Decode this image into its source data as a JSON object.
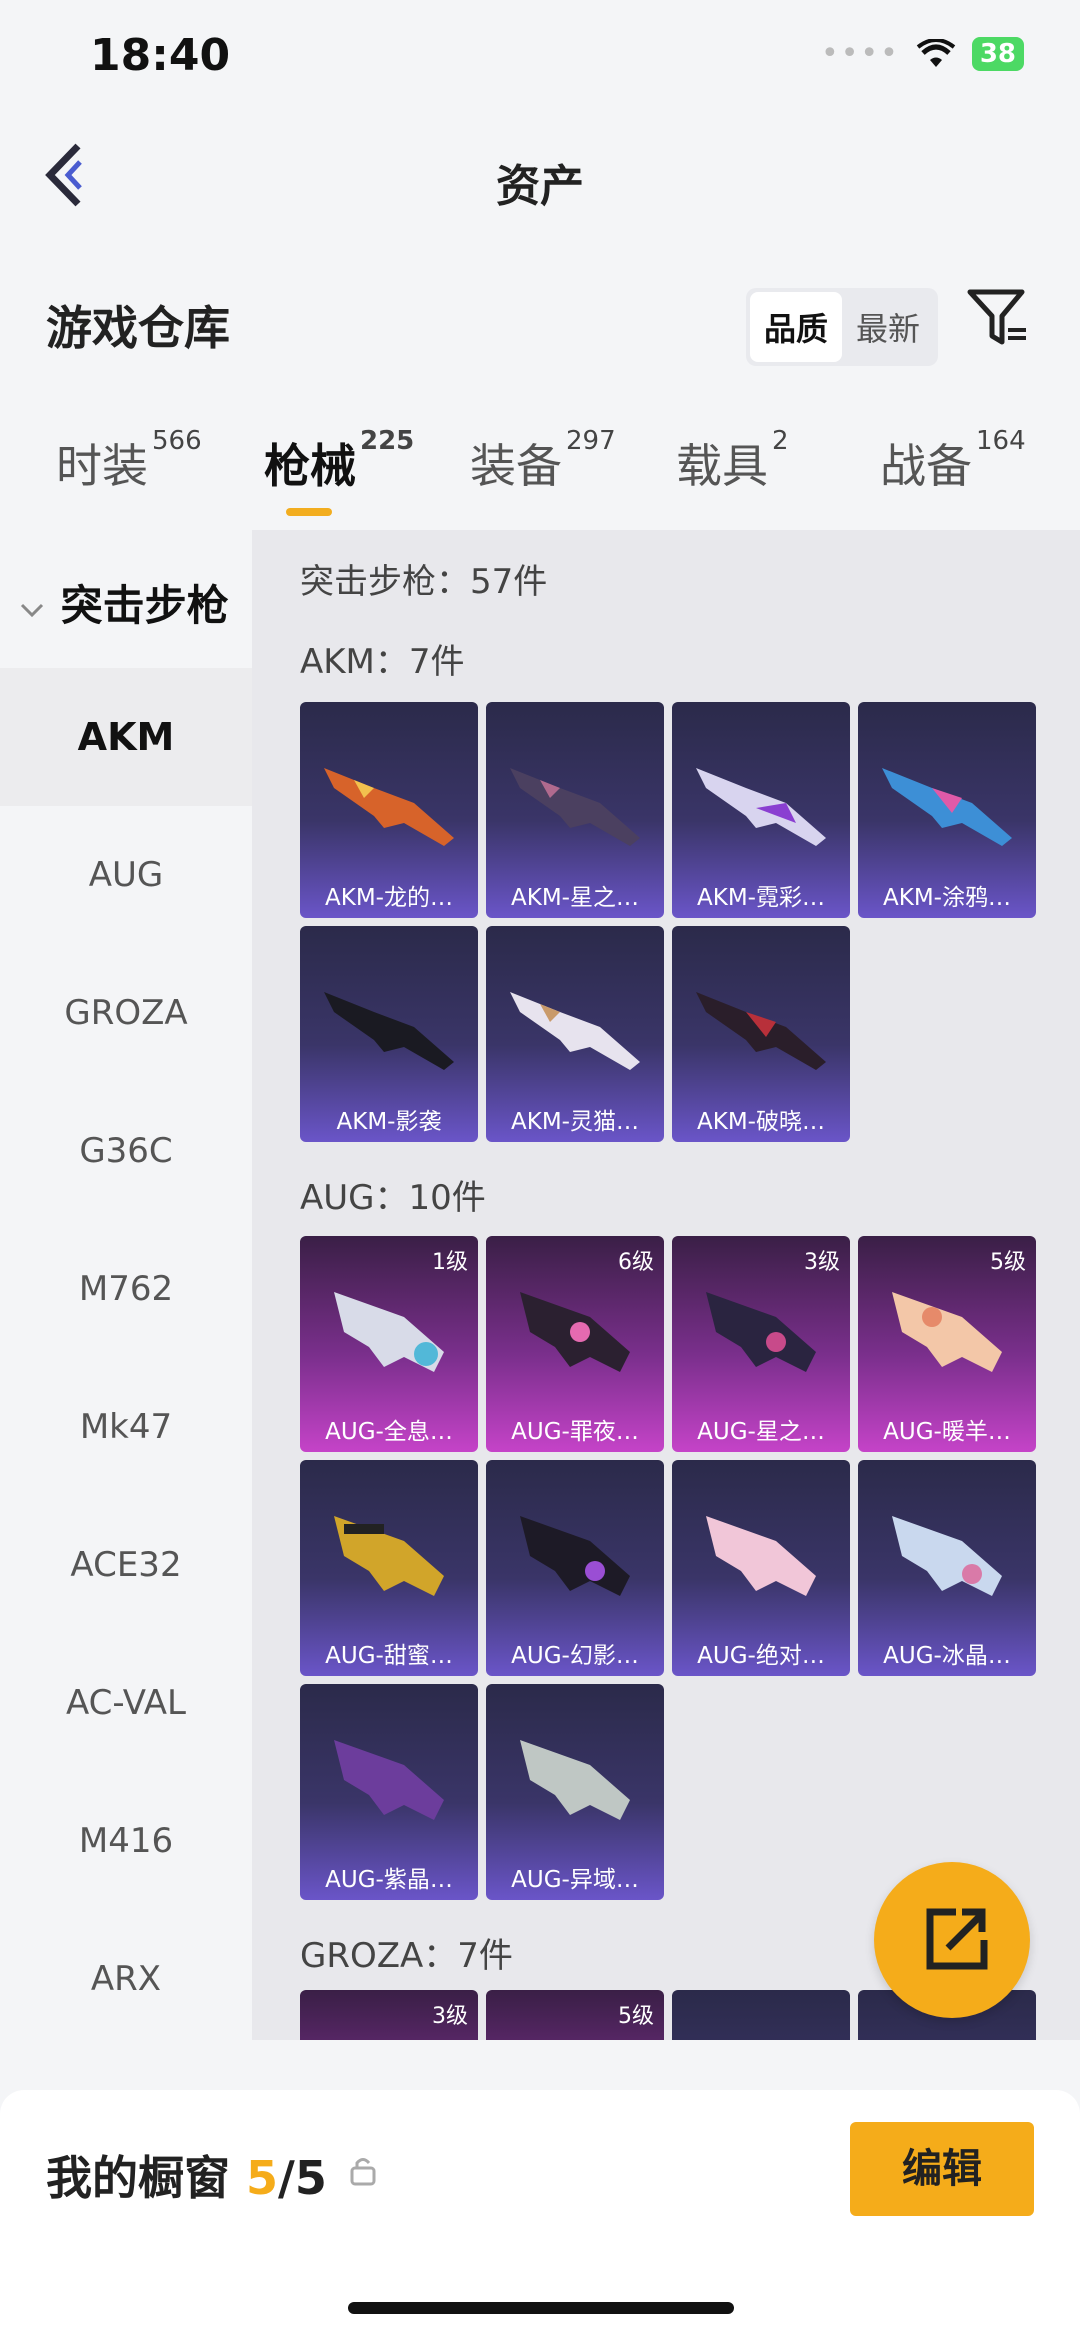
{
  "status": {
    "time": "18:40",
    "battery": "38"
  },
  "header": {
    "title": "资产"
  },
  "warehouse": {
    "title": "游戏仓库",
    "sort_quality": "品质",
    "sort_latest": "最新"
  },
  "tabs": [
    {
      "label": "时装",
      "count": "566"
    },
    {
      "label": "枪械",
      "count": "225"
    },
    {
      "label": "装备",
      "count": "297"
    },
    {
      "label": "载具",
      "count": "2"
    },
    {
      "label": "战备",
      "count": "164"
    }
  ],
  "sidebar": {
    "category": "突击步枪",
    "items": [
      "AKM",
      "AUG",
      "GROZA",
      "G36C",
      "M762",
      "Mk47",
      "ACE32",
      "AC-VAL",
      "M416",
      "ARX"
    ]
  },
  "content": {
    "summary": "突击步枪：57件",
    "sections": [
      {
        "title": "AKM：7件",
        "items": [
          {
            "label": "AKM-龙的…",
            "level": ""
          },
          {
            "label": "AKM-星之…",
            "level": ""
          },
          {
            "label": "AKM-霓彩…",
            "level": ""
          },
          {
            "label": "AKM-涂鸦…",
            "level": ""
          },
          {
            "label": "AKM-影袭",
            "level": ""
          },
          {
            "label": "AKM-灵猫…",
            "level": ""
          },
          {
            "label": "AKM-破晓…",
            "level": ""
          }
        ]
      },
      {
        "title": "AUG：10件",
        "items": [
          {
            "label": "AUG-全息…",
            "level": "1级"
          },
          {
            "label": "AUG-罪夜…",
            "level": "6级"
          },
          {
            "label": "AUG-星之…",
            "level": "3级"
          },
          {
            "label": "AUG-暖羊…",
            "level": "5级"
          },
          {
            "label": "AUG-甜蜜…",
            "level": ""
          },
          {
            "label": "AUG-幻影…",
            "level": ""
          },
          {
            "label": "AUG-绝对…",
            "level": ""
          },
          {
            "label": "AUG-冰晶…",
            "level": ""
          },
          {
            "label": "AUG-紫晶…",
            "level": ""
          },
          {
            "label": "AUG-异域…",
            "level": ""
          }
        ]
      },
      {
        "title": "GROZA：7件",
        "items": [
          {
            "label": "",
            "level": "3级"
          },
          {
            "label": "",
            "level": "5级"
          },
          {
            "label": "",
            "level": ""
          },
          {
            "label": "",
            "level": ""
          }
        ]
      }
    ]
  },
  "showcase": {
    "label": "我的橱窗",
    "current": "5",
    "total": "/5",
    "edit": "编辑"
  },
  "colors": {
    "accent": "#f5ac1a",
    "card_purple": "#6a55c8",
    "card_pink": "#c543c8"
  }
}
